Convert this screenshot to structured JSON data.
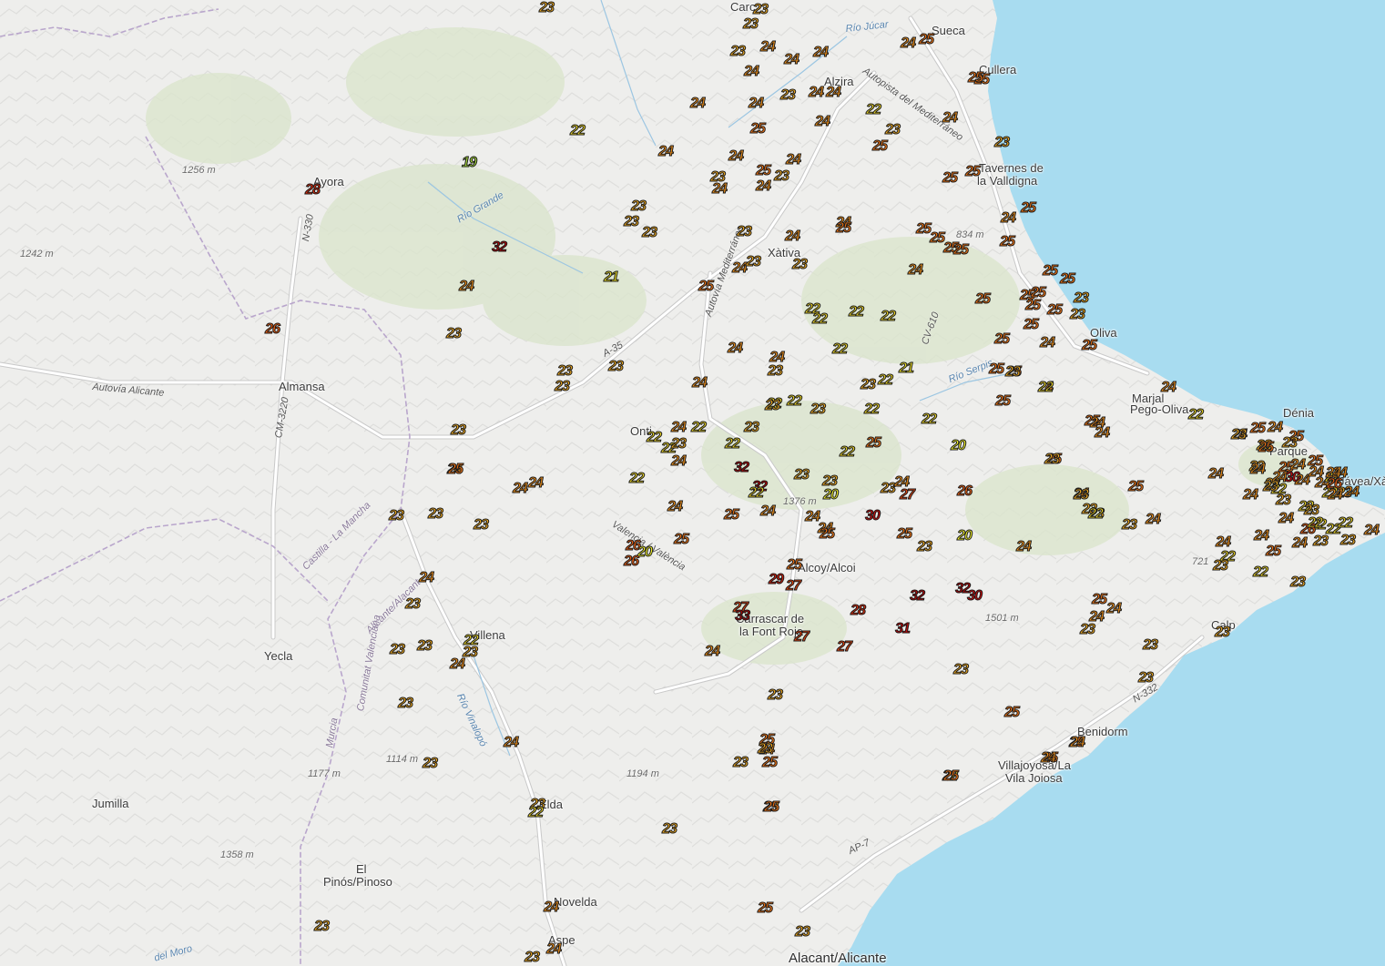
{
  "colors": {
    "land": "#eeeeec",
    "sea": "#a8dcf0",
    "hills": "#d6e2c6",
    "road": "#ffffff",
    "road_casing": "#c9c9c9",
    "admin_line": "#b9a6cc",
    "temp_scale": {
      "19": "#a4d93a",
      "20": "#f2f22a",
      "21": "#efe127",
      "22": "#e4ce25",
      "23": "#e9a51e",
      "24": "#ec8d18",
      "25": "#ea7012",
      "26": "#e35a10",
      "27": "#e0410d",
      "28": "#d82a0a",
      "29": "#d21c0a",
      "30": "#cc0b0b",
      "31": "#c20808",
      "32": "#b00606",
      "33": "#a80505"
    }
  },
  "places": [
    {
      "id": "ayora",
      "label": "Ayora",
      "big": false
    },
    {
      "id": "almansa",
      "label": "Almansa",
      "big": false
    },
    {
      "id": "yecla",
      "label": "Yecla",
      "big": false
    },
    {
      "id": "jumilla",
      "label": "Jumilla",
      "big": false
    },
    {
      "id": "el",
      "label": "El",
      "big": false
    },
    {
      "id": "pinoso",
      "label": "Pinós/Pinoso",
      "big": false
    },
    {
      "id": "villena",
      "label": "Villena",
      "big": false
    },
    {
      "id": "novelda",
      "label": "Novelda",
      "big": false
    },
    {
      "id": "aspe",
      "label": "Aspe",
      "big": false
    },
    {
      "id": "alacant",
      "label": "Alacant/Alicante",
      "big": true
    },
    {
      "id": "elda",
      "label": "Elda",
      "big": false
    },
    {
      "id": "xativa",
      "label": "Xàtiva",
      "big": false
    },
    {
      "id": "alzira",
      "label": "Alzira",
      "big": false
    },
    {
      "id": "carcaixent",
      "label": "Carc",
      "big": false
    },
    {
      "id": "sueca",
      "label": "Sueca",
      "big": false
    },
    {
      "id": "cullera",
      "label": "Cullera",
      "big": false
    },
    {
      "id": "tavernes1",
      "label": "Tavernes de",
      "big": false
    },
    {
      "id": "tavernes2",
      "label": "la Valldigna",
      "big": false
    },
    {
      "id": "oliva",
      "label": "Oliva",
      "big": false
    },
    {
      "id": "denia",
      "label": "Dénia",
      "big": false
    },
    {
      "id": "javea",
      "label": "Jávea/Xàb",
      "big": false
    },
    {
      "id": "calp",
      "label": "Calp",
      "big": false
    },
    {
      "id": "benidorm",
      "label": "Benidorm",
      "big": false
    },
    {
      "id": "villajoyosa1",
      "label": "Villajoyosa/La",
      "big": false
    },
    {
      "id": "villajoyosa2",
      "label": "Vila Joiosa",
      "big": false
    },
    {
      "id": "alcoy",
      "label": "Alcoy/Alcoi",
      "big": false
    },
    {
      "id": "ontinyent",
      "label": "Onti",
      "big": false
    },
    {
      "id": "carrascar1",
      "label": "Carrascar de",
      "big": false
    },
    {
      "id": "carrascar2",
      "label": "la Font Roja",
      "big": false
    },
    {
      "id": "marjal1",
      "label": "Marjal",
      "big": false
    },
    {
      "id": "marjal2",
      "label": "Pego-Oliva",
      "big": false
    },
    {
      "id": "parque",
      "label": "Parque",
      "big": false
    }
  ],
  "elevations": [
    "1256 m",
    "1242 m",
    "834 m",
    "1376 m",
    "1501 m",
    "1194 m",
    "1114 m",
    "1177 m",
    "1358 m",
    "721"
  ],
  "features": [
    {
      "id": "rio-jucar",
      "label": "Río Júcar",
      "kind": "water"
    },
    {
      "id": "rio-grande",
      "label": "Río Grande",
      "kind": "water"
    },
    {
      "id": "rio-serpis",
      "label": "Río Serpis",
      "kind": "water"
    },
    {
      "id": "rio-vinalopo",
      "label": "Río Vinalopó",
      "kind": "water"
    },
    {
      "id": "autovia-alicante",
      "label": "Autovía Alicante",
      "kind": "road"
    },
    {
      "id": "autopista-med",
      "label": "Autopista del Mediterráneo",
      "kind": "road"
    },
    {
      "id": "autovia-med",
      "label": "Autovía Mediterráneo",
      "kind": "road"
    },
    {
      "id": "n330",
      "label": "N-330",
      "kind": "road"
    },
    {
      "id": "cm3220",
      "label": "CM-3220",
      "kind": "road"
    },
    {
      "id": "a35",
      "label": "A-35",
      "kind": "road"
    },
    {
      "id": "cv610",
      "label": "CV-610",
      "kind": "road"
    },
    {
      "id": "ap7",
      "label": "AP-7",
      "kind": "road"
    },
    {
      "id": "n332",
      "label": "N-332",
      "kind": "road"
    },
    {
      "id": "valencia-valencia",
      "label": "Valencia / València",
      "kind": "road"
    },
    {
      "id": "castilla",
      "label": "Castilla - La Mancha",
      "kind": "admin"
    },
    {
      "id": "alicante-alacant",
      "label": "Alicante/Alacant",
      "kind": "admin"
    },
    {
      "id": "comunitat",
      "label": "Comunitat Valenciana",
      "kind": "admin"
    },
    {
      "id": "murcia",
      "label": "Murcia",
      "kind": "admin"
    },
    {
      "id": "del-moro",
      "label": "del Moro",
      "kind": "water"
    }
  ],
  "stations": [
    {
      "v": 23
    },
    {
      "v": 23
    },
    {
      "v": 23
    },
    {
      "v": 23
    },
    {
      "v": 24
    },
    {
      "v": 24
    },
    {
      "v": 24
    },
    {
      "v": 24
    },
    {
      "v": 24
    },
    {
      "v": 24
    },
    {
      "v": 23
    },
    {
      "v": 24
    },
    {
      "v": 24
    },
    {
      "v": 22
    },
    {
      "v": 23
    },
    {
      "v": 24
    },
    {
      "v": 25
    },
    {
      "v": 24
    },
    {
      "v": 25
    },
    {
      "v": 23
    },
    {
      "v": 25
    },
    {
      "v": 24
    },
    {
      "v": 25
    },
    {
      "v": 25
    },
    {
      "v": 24
    },
    {
      "v": 24
    },
    {
      "v": 25
    },
    {
      "v": 23
    },
    {
      "v": 23
    },
    {
      "v": 24
    },
    {
      "v": 24
    },
    {
      "v": 24
    },
    {
      "v": 25
    },
    {
      "v": 25
    },
    {
      "v": 22
    },
    {
      "v": 19
    },
    {
      "v": 28
    },
    {
      "v": 32
    },
    {
      "v": 24
    },
    {
      "v": 23
    },
    {
      "v": 26
    },
    {
      "v": 23
    },
    {
      "v": 23
    },
    {
      "v": 23
    },
    {
      "v": 21
    },
    {
      "v": 23
    },
    {
      "v": 24
    },
    {
      "v": 23
    },
    {
      "v": 24
    },
    {
      "v": 23
    },
    {
      "v": 25
    },
    {
      "v": 23
    },
    {
      "v": 23
    },
    {
      "v": 23
    },
    {
      "v": 24
    },
    {
      "v": 24
    },
    {
      "v": 23
    },
    {
      "v": 24
    },
    {
      "v": 23
    },
    {
      "v": 24
    },
    {
      "v": 22
    },
    {
      "v": 22
    },
    {
      "v": 22
    },
    {
      "v": 22
    },
    {
      "v": 24
    },
    {
      "v": 22
    },
    {
      "v": 25
    },
    {
      "v": 24
    },
    {
      "v": 24
    },
    {
      "v": 23
    },
    {
      "v": 23
    },
    {
      "v": 23
    },
    {
      "v": 24
    },
    {
      "v": 23
    },
    {
      "v": 23
    },
    {
      "v": 23
    },
    {
      "v": 22
    },
    {
      "v": 23
    },
    {
      "v": 24
    },
    {
      "v": 23
    },
    {
      "v": 24
    },
    {
      "v": 23
    },
    {
      "v": 23
    },
    {
      "v": 22
    },
    {
      "v": 23
    },
    {
      "v": 23
    },
    {
      "v": 24
    },
    {
      "v": 25
    },
    {
      "v": 25
    },
    {
      "v": 25
    },
    {
      "v": 25
    },
    {
      "v": 25
    },
    {
      "v": 25
    },
    {
      "v": 24
    },
    {
      "v": 25
    },
    {
      "v": 25
    },
    {
      "v": 25
    },
    {
      "v": 25
    },
    {
      "v": 25
    },
    {
      "v": 25
    },
    {
      "v": 25
    },
    {
      "v": 23
    },
    {
      "v": 23
    },
    {
      "v": 25
    },
    {
      "v": 25
    },
    {
      "v": 24
    },
    {
      "v": 25
    },
    {
      "v": 25
    },
    {
      "v": 24
    },
    {
      "v": 25
    },
    {
      "v": 24
    },
    {
      "v": 25
    },
    {
      "v": 24
    },
    {
      "v": 22
    },
    {
      "v": 25
    },
    {
      "v": 24
    },
    {
      "v": 24
    },
    {
      "v": 25
    },
    {
      "v": 24
    },
    {
      "v": 24
    },
    {
      "v": 25
    },
    {
      "v": 24
    },
    {
      "v": 25
    },
    {
      "v": 23
    },
    {
      "v": 23
    },
    {
      "v": 22
    },
    {
      "v": 22
    },
    {
      "v": 22
    },
    {
      "v": 22
    },
    {
      "v": 22
    },
    {
      "v": 23
    },
    {
      "v": 22
    },
    {
      "v": 21
    },
    {
      "v": 22
    },
    {
      "v": 23
    },
    {
      "v": 23
    },
    {
      "v": 23
    },
    {
      "v": 22
    },
    {
      "v": 32
    },
    {
      "v": 32
    },
    {
      "v": 22
    },
    {
      "v": 23
    },
    {
      "v": 23
    },
    {
      "v": 20
    },
    {
      "v": 23
    },
    {
      "v": 24
    },
    {
      "v": 27
    },
    {
      "v": 26
    },
    {
      "v": 24
    },
    {
      "v": 25
    },
    {
      "v": 24
    },
    {
      "v": 24
    },
    {
      "v": 24
    },
    {
      "v": 25
    },
    {
      "v": 30
    },
    {
      "v": 25
    },
    {
      "v": 23
    },
    {
      "v": 20
    },
    {
      "v": 24
    },
    {
      "v": 22
    },
    {
      "v": 22
    },
    {
      "v": 23
    },
    {
      "v": 24
    },
    {
      "v": 22
    },
    {
      "v": 25
    },
    {
      "v": 20
    },
    {
      "v": 25
    },
    {
      "v": 26
    },
    {
      "v": 20
    },
    {
      "v": 26
    },
    {
      "v": 25
    },
    {
      "v": 29
    },
    {
      "v": 27
    },
    {
      "v": 27
    },
    {
      "v": 33
    },
    {
      "v": 28
    },
    {
      "v": 32
    },
    {
      "v": 32
    },
    {
      "v": 30
    },
    {
      "v": 31
    },
    {
      "v": 27
    },
    {
      "v": 27
    },
    {
      "v": 24
    },
    {
      "v": 23
    },
    {
      "v": 25
    },
    {
      "v": 24
    },
    {
      "v": 23
    },
    {
      "v": 23
    },
    {
      "v": 25
    },
    {
      "v": 25
    },
    {
      "v": 25
    },
    {
      "v": 23
    },
    {
      "v": 23
    },
    {
      "v": 22
    },
    {
      "v": 23
    },
    {
      "v": 25
    },
    {
      "v": 24
    },
    {
      "v": 25
    },
    {
      "v": 25
    },
    {
      "v": 23
    },
    {
      "v": 24
    },
    {
      "v": 24
    },
    {
      "v": 23
    },
    {
      "v": 23
    },
    {
      "v": 25
    },
    {
      "v": 24
    },
    {
      "v": 25
    },
    {
      "v": 23
    },
    {
      "v": 22
    },
    {
      "v": 23
    },
    {
      "v": 24
    },
    {
      "v": 23
    },
    {
      "v": 23
    },
    {
      "v": 23
    },
    {
      "v": 24
    },
    {
      "v": 24
    },
    {
      "v": 23
    },
    {
      "v": 24
    },
    {
      "v": 25
    },
    {
      "v": 23
    },
    {
      "v": 25
    },
    {
      "v": 24
    },
    {
      "v": 24
    },
    {
      "v": 22
    },
    {
      "v": 24
    },
    {
      "v": 24
    },
    {
      "v": 22
    },
    {
      "v": 22
    },
    {
      "v": 23
    },
    {
      "v": 26
    },
    {
      "v": 22
    },
    {
      "v": 23
    },
    {
      "v": 22
    },
    {
      "v": 22
    },
    {
      "v": 23
    },
    {
      "v": 24
    },
    {
      "v": 22
    },
    {
      "v": 23
    },
    {
      "v": 24
    },
    {
      "v": 23
    },
    {
      "v": 23
    },
    {
      "v": 24
    },
    {
      "v": 22
    },
    {
      "v": 30
    },
    {
      "v": 24
    },
    {
      "v": 24
    },
    {
      "v": 24
    },
    {
      "v": 22
    },
    {
      "v": 22
    },
    {
      "v": 23
    },
    {
      "v": 24
    },
    {
      "v": 26
    },
    {
      "v": 25
    },
    {
      "v": 24
    },
    {
      "v": 23
    },
    {
      "v": 23
    },
    {
      "v": 25
    },
    {
      "v": 24
    },
    {
      "v": 25
    },
    {
      "v": 24
    },
    {
      "v": 24
    },
    {
      "v": 24
    },
    {
      "v": 25
    },
    {
      "v": 23
    },
    {
      "v": 22
    },
    {
      "v": 23
    },
    {
      "v": 23
    },
    {
      "v": 25
    },
    {
      "v": 24
    },
    {
      "v": 23
    },
    {
      "v": 25
    }
  ]
}
